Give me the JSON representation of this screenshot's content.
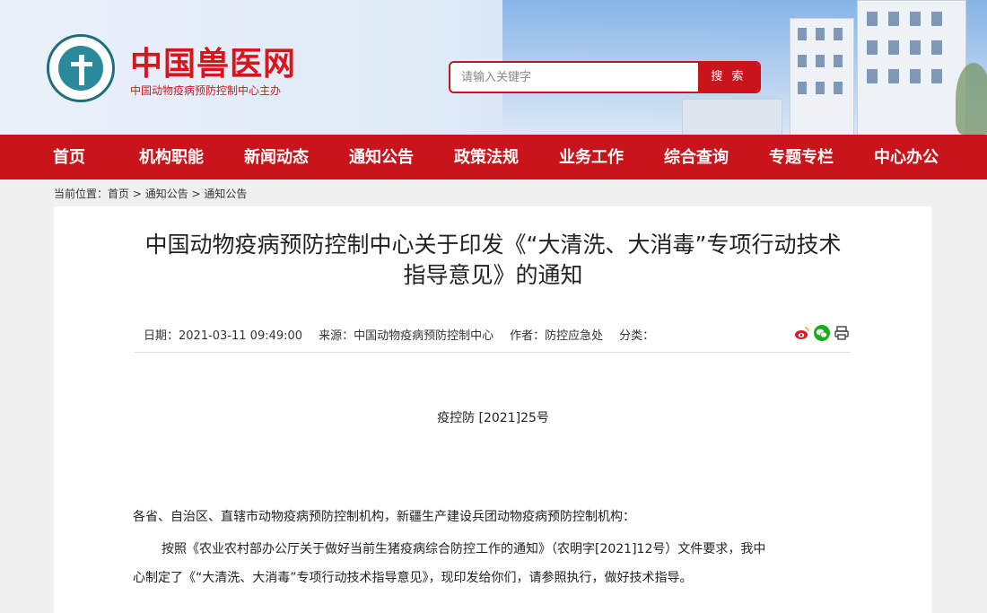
{
  "header": {
    "site_title": "中国兽医网",
    "site_subtitle": "中国动物疫病预防控制中心主办",
    "search_placeholder": "请输入关键字",
    "search_button": "搜 索"
  },
  "nav": [
    "首页",
    "机构职能",
    "新闻动态",
    "通知公告",
    "政策法规",
    "业务工作",
    "综合查询",
    "专题专栏",
    "中心办公"
  ],
  "breadcrumb": {
    "prefix": "当前位置：",
    "items": [
      "首页",
      "通知公告",
      "通知公告"
    ],
    "separator": " > "
  },
  "article": {
    "title_line1": "中国动物疫病预防控制中心关于印发《“大清洗、大消毒”专项行动技术",
    "title_line2": "指导意见》的通知",
    "date": "日期：2021-03-11 09:49:00",
    "source": "来源：中国动物疫病预防控制中心",
    "author": "作者：防控应急处",
    "category": "分类：",
    "doc_number": "疫控防 [2021]25号",
    "salutation": "各省、自治区、直辖市动物疫病预防控制机构，新疆生产建设兵团动物疫病预防控制机构：",
    "body_line1": "按照《农业农村部办公厅关于做好当前生猪疫病综合防控工作的通知》（农明字[2021]12号）文件要求，我中",
    "body_line2": "心制定了《“大清洗、大消毒”专项行动技术指导意见》，现印发给你们，请参照执行，做好技术指导。"
  },
  "share_icons": [
    "weibo-icon",
    "wechat-icon",
    "print-icon"
  ]
}
